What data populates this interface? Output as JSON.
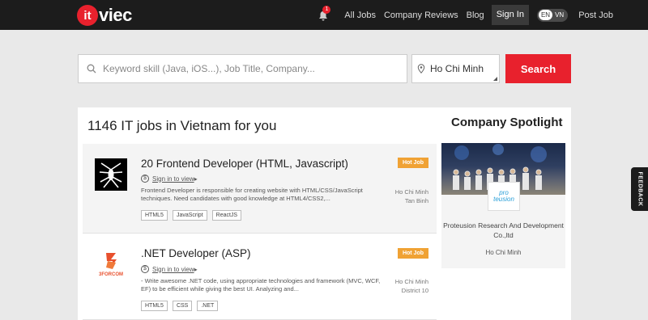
{
  "brand": {
    "badge": "it",
    "text": "viec"
  },
  "nav": {
    "notification_count": "1",
    "all_jobs": "All Jobs",
    "company_reviews": "Company Reviews",
    "blog": "Blog",
    "sign_in": "Sign In",
    "lang_en": "EN",
    "lang_vn": "VN",
    "post_job": "Post Job"
  },
  "search": {
    "placeholder": "Keyword skill (Java, iOS...), Job Title, Company...",
    "city": "Ho Chi Minh",
    "button": "Search"
  },
  "main": {
    "heading": "1146 IT jobs in Vietnam for you"
  },
  "jobs": [
    {
      "title": "20 Frontend Developer (HTML, Javascript)",
      "sign_in": "Sign in to view",
      "desc": "Frontend Developer is responsible for creating website with HTML/CSS/JavaScript techniques. Need candidates with good knowledge at HTML4/CSS2,...",
      "tags": [
        "HTML5",
        "JavaScript",
        "ReactJS"
      ],
      "badge": "Hot Job",
      "city": "Ho Chi Minh",
      "district": "Tan Binh"
    },
    {
      "title": ".NET Developer (ASP)",
      "sign_in": "Sign in to view",
      "desc": "- Write awesome .NET code, using appropriate technologies and framework (MVC, WCF, EF) to be efficient while giving the best UI. Analyzing and...",
      "tags": [
        "HTML5",
        "CSS",
        ".NET"
      ],
      "badge": "Hot Job",
      "city": "Ho Chi Minh",
      "district": "District 10",
      "logo_text": "3FORCOM"
    }
  ],
  "spotlight": {
    "title": "Company Spotlight",
    "logo_line1": "pro",
    "logo_line2": "teusion",
    "company": "Proteusion Research And Development Co.,ltd",
    "city": "Ho Chi Minh"
  },
  "feedback": "FEEDBACK",
  "colors": {
    "accent": "#e8212d",
    "hot": "#f0a234",
    "nav": "#1c1c1c"
  }
}
